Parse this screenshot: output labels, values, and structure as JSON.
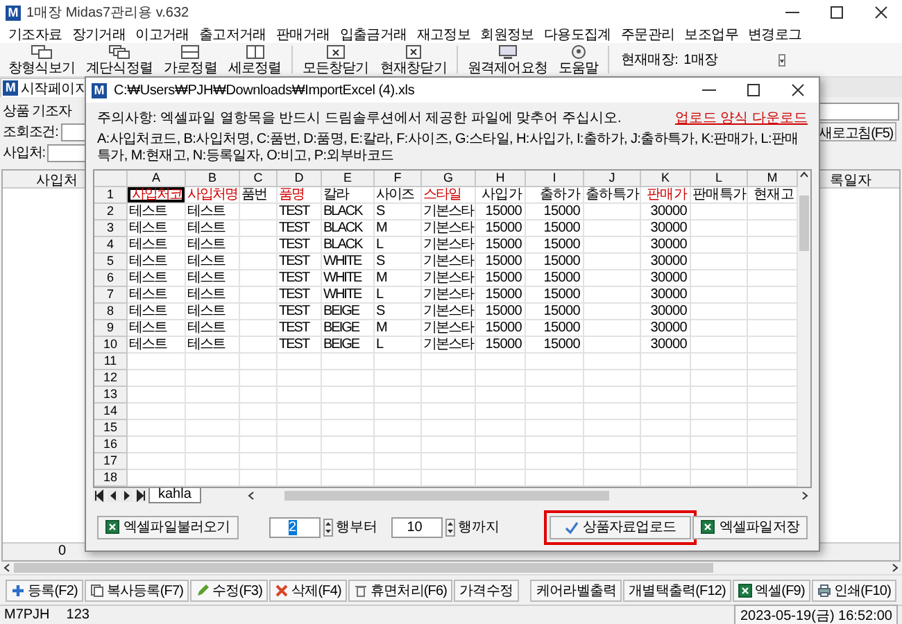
{
  "window": {
    "icon": "M",
    "title": "1매장 Midas7관리용 v.632"
  },
  "menu": [
    "기조자료",
    "장기거래",
    "이고거래",
    "출고저거래",
    "판매거래",
    "입출금거래",
    "재고정보",
    "회원정보",
    "다용도집계",
    "주문관리",
    "보조업무",
    "변경로그"
  ],
  "toolbar": {
    "groups": [
      [
        {
          "label": "창형식보기"
        },
        {
          "label": "계단식정렬"
        },
        {
          "label": "가로정렬"
        },
        {
          "label": "세로정렬"
        }
      ],
      [
        {
          "label": "모든창닫기"
        },
        {
          "label": "현재창닫기"
        }
      ],
      [
        {
          "label": "원격제어요청"
        },
        {
          "label": "도움말"
        }
      ]
    ],
    "store_label": "현재매장:",
    "store": "1매장"
  },
  "start_tab": {
    "icon": "M",
    "label": "시작페이지"
  },
  "form": {
    "title": "상품 기조자",
    "filter_label": "조회조건:",
    "vendor_label": "사입처:",
    "refresh_button": "새로고침(F5)"
  },
  "list": {
    "column_1": "사입처",
    "column_2": "록일자",
    "footer_value": "0"
  },
  "dialog": {
    "icon": "M",
    "title": "C:₩Users₩PJH₩Downloads₩ImportExcel (4).xls",
    "notice": "주의사항: 엑셀파일 열항목을 반드시 드림솔루션에서 제공한 파일에 맞추어 주십시오.",
    "download_link": "업로드 양식 다운로드",
    "legend": "A:사입처코드, B:사입처명, C:품번, D:품명, E:칼라, F:사이즈, G:스타일, H:사입가, I:출하가, J:출하특가, K:판매가, L:판매특가, M:현재고, N:등록일자, O:비고, P:외부바코드",
    "sheet": {
      "columns": [
        "A",
        "B",
        "C",
        "D",
        "E",
        "F",
        "G",
        "H",
        "I",
        "J",
        "K",
        "L",
        "M"
      ],
      "header_row": {
        "number": "1",
        "cells": [
          {
            "text": "사입처코",
            "required": true,
            "selected": true
          },
          {
            "text": "사입처명",
            "required": true,
            "selected": false
          },
          {
            "text": "품번",
            "required": false,
            "selected": false
          },
          {
            "text": "품명",
            "required": true,
            "selected": false
          },
          {
            "text": "칼라",
            "required": false,
            "selected": false
          },
          {
            "text": "사이즈",
            "required": false,
            "selected": false
          },
          {
            "text": "스타일",
            "required": true,
            "selected": false
          },
          {
            "text": "사입가",
            "required": false,
            "selected": false
          },
          {
            "text": "출하가",
            "required": false,
            "selected": false
          },
          {
            "text": "출하특가",
            "required": false,
            "selected": false
          },
          {
            "text": "판매가",
            "required": true,
            "selected": false
          },
          {
            "text": "판매특가",
            "required": false,
            "selected": false
          },
          {
            "text": "현재고",
            "required": false,
            "selected": false
          }
        ]
      },
      "rows": [
        {
          "number": "2",
          "cells": [
            "테스트",
            "테스트",
            null,
            "TEST",
            "BLACK",
            "S",
            "기본스타",
            "15000",
            "15000",
            null,
            "30000",
            null,
            null
          ]
        },
        {
          "number": "3",
          "cells": [
            "테스트",
            "테스트",
            null,
            "TEST",
            "BLACK",
            "M",
            "기본스타",
            "15000",
            "15000",
            null,
            "30000",
            null,
            null
          ]
        },
        {
          "number": "4",
          "cells": [
            "테스트",
            "테스트",
            null,
            "TEST",
            "BLACK",
            "L",
            "기본스타",
            "15000",
            "15000",
            null,
            "30000",
            null,
            null
          ]
        },
        {
          "number": "5",
          "cells": [
            "테스트",
            "테스트",
            null,
            "TEST",
            "WHITE",
            "S",
            "기본스타",
            "15000",
            "15000",
            null,
            "30000",
            null,
            null
          ]
        },
        {
          "number": "6",
          "cells": [
            "테스트",
            "테스트",
            null,
            "TEST",
            "WHITE",
            "M",
            "기본스타",
            "15000",
            "15000",
            null,
            "30000",
            null,
            null
          ]
        },
        {
          "number": "7",
          "cells": [
            "테스트",
            "테스트",
            null,
            "TEST",
            "WHITE",
            "L",
            "기본스타",
            "15000",
            "15000",
            null,
            "30000",
            null,
            null
          ]
        },
        {
          "number": "8",
          "cells": [
            "테스트",
            "테스트",
            null,
            "TEST",
            "BEIGE",
            "S",
            "기본스타",
            "15000",
            "15000",
            null,
            "30000",
            null,
            null
          ]
        },
        {
          "number": "9",
          "cells": [
            "테스트",
            "테스트",
            null,
            "TEST",
            "BEIGE",
            "M",
            "기본스타",
            "15000",
            "15000",
            null,
            "30000",
            null,
            null
          ]
        },
        {
          "number": "10",
          "cells": [
            "테스트",
            "테스트",
            null,
            "TEST",
            "BEIGE",
            "L",
            "기본스타",
            "15000",
            "15000",
            null,
            "30000",
            null,
            null
          ]
        }
      ],
      "empty_rows": [
        "11",
        "12",
        "13",
        "14",
        "15",
        "16",
        "17",
        "18"
      ]
    },
    "sheet_tab": "kahla",
    "open_button": "엑셀파일불러오기",
    "from": {
      "value": "2",
      "text_selected": true,
      "label": "행부터"
    },
    "to": {
      "value": "10",
      "text_selected": false,
      "label": "행까지"
    },
    "upload_button": {
      "label": "상품자료업로드",
      "highlighted": true
    },
    "save_button": "엑셀파일저장"
  },
  "actions_left": [
    {
      "label": "등록(F2)"
    },
    {
      "label": "복사등록(F7)"
    },
    {
      "label": "수정(F3)"
    },
    {
      "label": "삭제(F4)"
    },
    {
      "label": "휴면처리(F6)"
    },
    {
      "label": "가격수정"
    }
  ],
  "actions_right": [
    {
      "label": "케어라벨출력"
    },
    {
      "label": "개별택출력(F12)"
    },
    {
      "label": "엑셀(F9)"
    },
    {
      "label": "인쇄(F10)"
    }
  ],
  "status": {
    "user": "M7PJH",
    "code": "123",
    "datetime": "2023-05-19(금) 16:52:00"
  }
}
